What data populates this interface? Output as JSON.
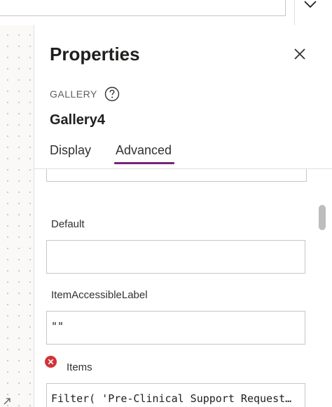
{
  "panel": {
    "title": "Properties",
    "control_type": "GALLERY",
    "control_name": "Gallery4",
    "tabs": [
      {
        "label": "Display",
        "active": false
      },
      {
        "label": "Advanced",
        "active": true
      }
    ],
    "accent_color": "#742774"
  },
  "properties": [
    {
      "label": "Default",
      "value": "",
      "error": false
    },
    {
      "label": "ItemAccessibleLabel",
      "value": "\"\"",
      "error": false
    },
    {
      "label": "Items",
      "value": "Filter( 'Pre-Clinical Support Request…",
      "error": true
    }
  ],
  "icons": {
    "top_right": "chevron-down-icon",
    "close": "close-icon",
    "help": "help-circle-icon",
    "error": "error-circle-icon",
    "resize": "resize-arrow-icon"
  },
  "colors": {
    "error": "#d13438",
    "border": "#c8c6c4"
  }
}
